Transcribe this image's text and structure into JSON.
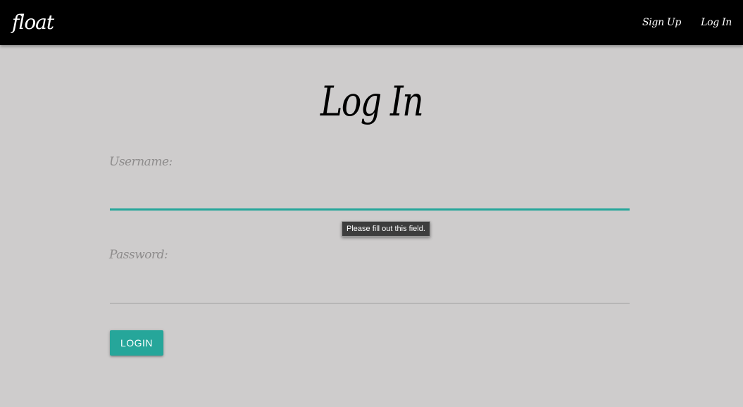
{
  "navbar": {
    "brand": "float",
    "links": [
      {
        "label": "Sign Up"
      },
      {
        "label": "Log In"
      }
    ]
  },
  "page": {
    "title": "Log In"
  },
  "form": {
    "username": {
      "label": "Username:",
      "value": ""
    },
    "password": {
      "label": "Password:",
      "value": ""
    },
    "validation_tooltip": "Please fill out this field.",
    "submit_label": "LOGIN"
  },
  "colors": {
    "navbar_bg": "#000000",
    "page_bg": "#cecccc",
    "accent": "#26a69a",
    "label": "#8e8c8c"
  }
}
